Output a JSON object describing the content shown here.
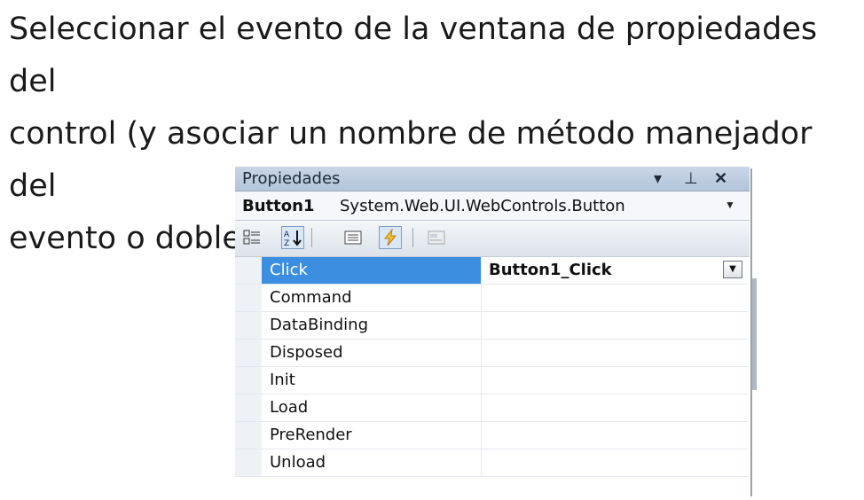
{
  "slide": {
    "lines": [
      "Seleccionar el evento de la ventana de propiedades del",
      "control (y asociar un nombre de método manejador del",
      "evento o doble click)"
    ]
  },
  "panel": {
    "title": "Propiedades",
    "title_buttons": [
      "dropdown-icon",
      "pin-icon",
      "close-icon"
    ],
    "object_name": "Button1",
    "object_type": "System.Web.UI.WebControls.Button",
    "toolbar": [
      "categorized-icon",
      "alphabetical-icon",
      "properties-icon",
      "events-icon",
      "property-pages-icon"
    ],
    "active_tools": [
      "alphabetical-icon",
      "events-icon"
    ],
    "events": [
      {
        "name": "Click",
        "value": "Button1_Click",
        "selected": true
      },
      {
        "name": "Command",
        "value": ""
      },
      {
        "name": "DataBinding",
        "value": ""
      },
      {
        "name": "Disposed",
        "value": ""
      },
      {
        "name": "Init",
        "value": ""
      },
      {
        "name": "Load",
        "value": ""
      },
      {
        "name": "PreRender",
        "value": ""
      },
      {
        "name": "Unload",
        "value": ""
      }
    ],
    "colors": {
      "selection": "#3c8ee0",
      "title_bar": "#c9d6e6"
    }
  }
}
